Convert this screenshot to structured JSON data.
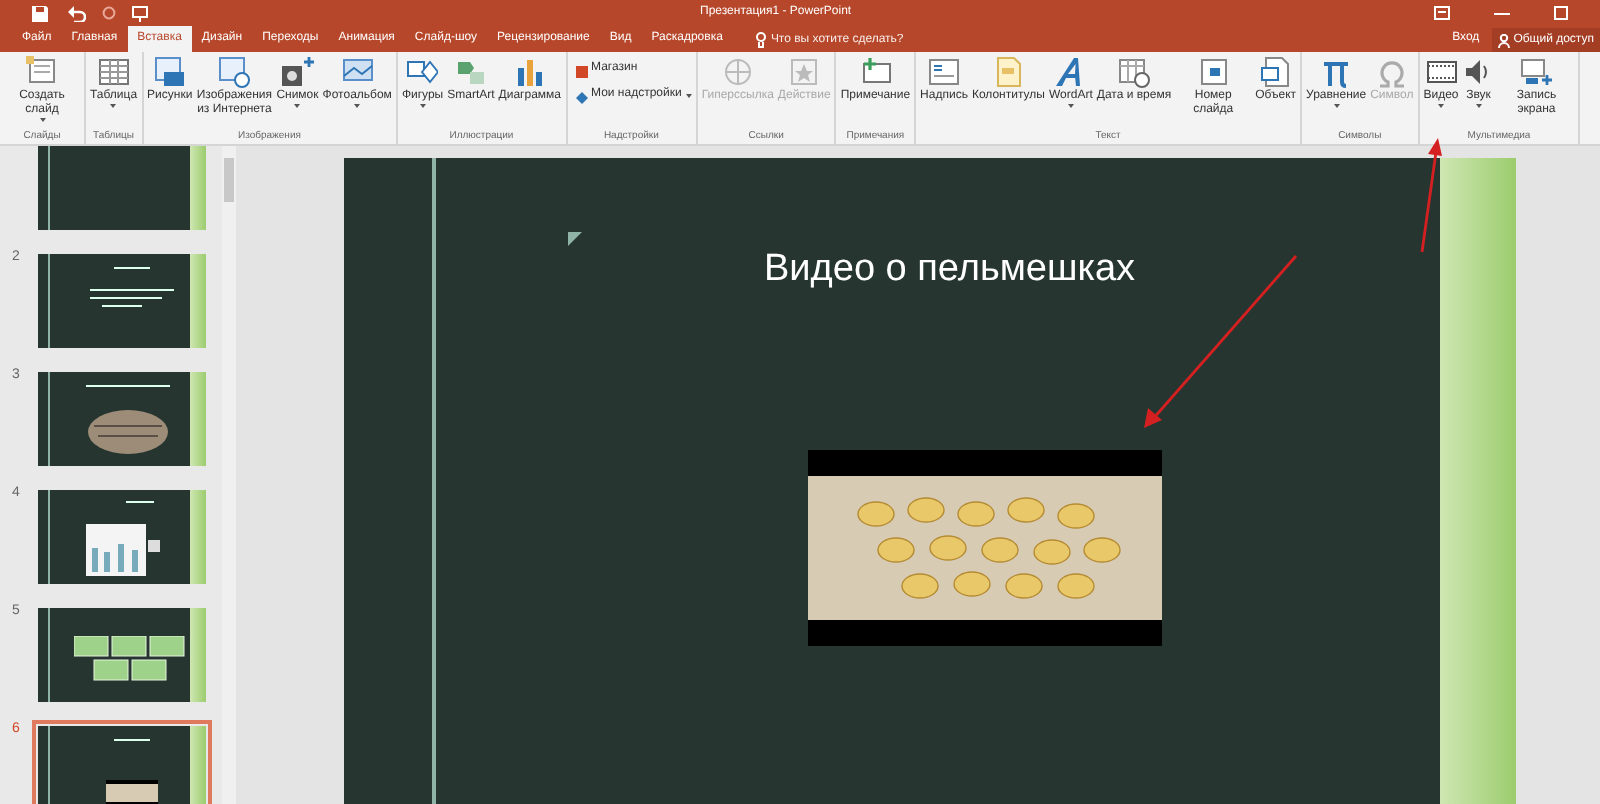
{
  "window": {
    "title": "Презентация1 - PowerPoint"
  },
  "tabs": [
    {
      "label": "Файл",
      "selected": false
    },
    {
      "label": "Главная",
      "selected": false
    },
    {
      "label": "Вставка",
      "selected": true
    },
    {
      "label": "Дизайн",
      "selected": false
    },
    {
      "label": "Переходы",
      "selected": false
    },
    {
      "label": "Анимация",
      "selected": false
    },
    {
      "label": "Слайд-шоу",
      "selected": false
    },
    {
      "label": "Рецензирование",
      "selected": false
    },
    {
      "label": "Вид",
      "selected": false
    },
    {
      "label": "Раскадровка",
      "selected": false
    }
  ],
  "tell_me": {
    "placeholder": "Что вы хотите сделать?"
  },
  "account": {
    "sign_in": "Вход",
    "share": "Общий доступ"
  },
  "ribbon_groups": [
    {
      "label": "Слайды",
      "buttons": [
        {
          "label": "Создать слайд",
          "dropdown": true,
          "disabled": false
        }
      ]
    },
    {
      "label": "Таблицы",
      "buttons": [
        {
          "label": "Таблица",
          "dropdown": true,
          "disabled": false
        }
      ]
    },
    {
      "label": "Изображения",
      "buttons": [
        {
          "label": "Рисунки",
          "dropdown": false,
          "disabled": false
        },
        {
          "label": "Изображения из Интернета",
          "dropdown": false,
          "disabled": false
        },
        {
          "label": "Снимок",
          "dropdown": true,
          "disabled": false
        },
        {
          "label": "Фотоальбом",
          "dropdown": true,
          "disabled": false
        }
      ]
    },
    {
      "label": "Иллюстрации",
      "buttons": [
        {
          "label": "Фигуры",
          "dropdown": true,
          "disabled": false
        },
        {
          "label": "SmartArt",
          "dropdown": false,
          "disabled": false
        },
        {
          "label": "Диаграмма",
          "dropdown": false,
          "disabled": false
        }
      ]
    },
    {
      "label": "Надстройки",
      "buttons": [
        {
          "label": "Магазин",
          "dropdown": false,
          "disabled": false,
          "kind": "small"
        },
        {
          "label": "Мои надстройки",
          "dropdown": true,
          "disabled": false,
          "kind": "small"
        }
      ]
    },
    {
      "label": "Ссылки",
      "buttons": [
        {
          "label": "Гиперссылка",
          "dropdown": false,
          "disabled": true
        },
        {
          "label": "Действие",
          "dropdown": false,
          "disabled": true
        }
      ]
    },
    {
      "label": "Примечания",
      "buttons": [
        {
          "label": "Примечание",
          "dropdown": false,
          "disabled": false
        }
      ]
    },
    {
      "label": "Текст",
      "buttons": [
        {
          "label": "Надпись",
          "dropdown": false,
          "disabled": false
        },
        {
          "label": "Колонтитулы",
          "dropdown": false,
          "disabled": false
        },
        {
          "label": "WordArt",
          "dropdown": true,
          "disabled": false
        },
        {
          "label": "Дата и время",
          "dropdown": false,
          "disabled": false
        },
        {
          "label": "Номер слайда",
          "dropdown": false,
          "disabled": false
        },
        {
          "label": "Объект",
          "dropdown": false,
          "disabled": false
        }
      ]
    },
    {
      "label": "Символы",
      "buttons": [
        {
          "label": "Уравнение",
          "dropdown": true,
          "disabled": false
        },
        {
          "label": "Символ",
          "dropdown": false,
          "disabled": true
        }
      ]
    },
    {
      "label": "Мультимедиа",
      "buttons": [
        {
          "label": "Видео",
          "dropdown": true,
          "disabled": false
        },
        {
          "label": "Звук",
          "dropdown": true,
          "disabled": false
        },
        {
          "label": "Запись экрана",
          "dropdown": false,
          "disabled": false
        }
      ]
    }
  ],
  "slides": [
    {
      "kind": "plain",
      "selected": false
    },
    {
      "number": "2",
      "kind": "text",
      "selected": false
    },
    {
      "number": "3",
      "kind": "image",
      "selected": false
    },
    {
      "number": "4",
      "kind": "chart",
      "selected": false
    },
    {
      "number": "5",
      "kind": "boxes",
      "selected": false
    },
    {
      "number": "6",
      "kind": "video",
      "selected": true
    }
  ],
  "slide": {
    "title": "Видео о пельмешках"
  }
}
